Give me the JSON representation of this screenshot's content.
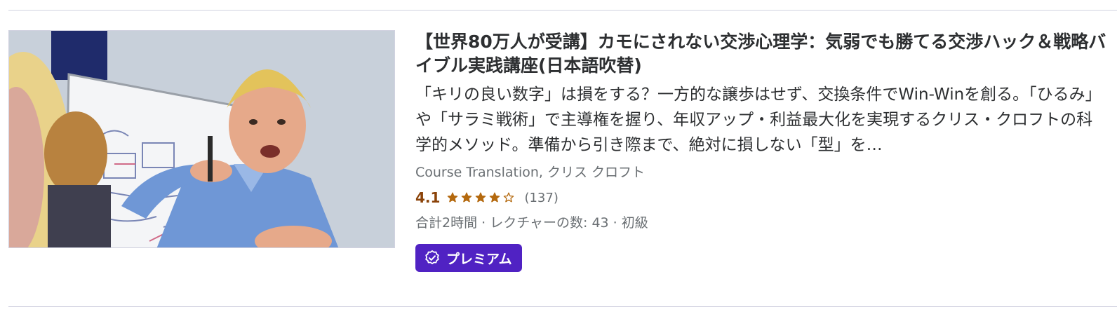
{
  "course": {
    "title": "【世界80万人が受講】カモにされない交渉心理学：気弱でも勝てる交渉ハック＆戦略バイブル実践講座(日本語吹替)",
    "headline": "「キリの良い数字」は損をする？一方的な譲歩はせず、交換条件でWin-Winを創る。「ひるみ」や「サラミ戦術」で主導権を握り、年収アップ・利益最大化を実現するクリス・クロフトの科学的メソッド。準備から引き際まで、絶対に損しない「型」を…",
    "instructors": "Course Translation, クリス クロフト",
    "rating": "4.1",
    "rating_fraction": 0.82,
    "stars": [
      "full",
      "full",
      "full",
      "full",
      "empty"
    ],
    "rating_count": "(137)",
    "meta": "合計2時間 · レクチャーの数: 43 · 初級",
    "badge_label": "プレミアム",
    "badge_icon": "verified-badge-icon",
    "thumbnail_icon": "instructor-photo"
  },
  "colors": {
    "rating": "#b4690e",
    "rating_text": "#8b4309",
    "badge_bg": "#5022c3",
    "muted_text": "#6a6f73",
    "divider": "#d1d2e0"
  }
}
